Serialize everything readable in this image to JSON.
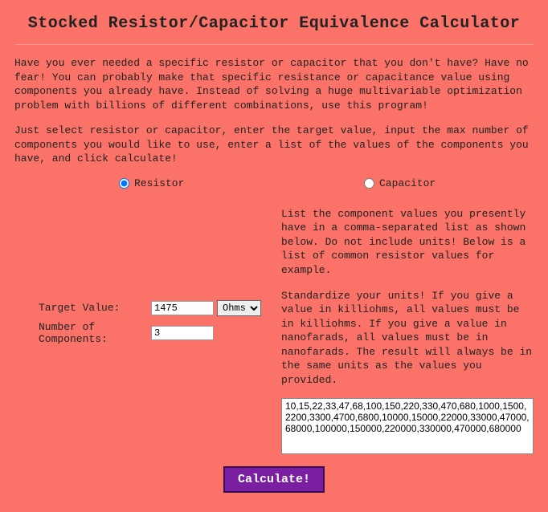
{
  "title": "Stocked Resistor/Capacitor Equivalence Calculator",
  "intro1": "Have you ever needed a specific resistor or capacitor that you don't have? Have no fear! You can probably make that specific resistance or capacitance value using components you already have. Instead of solving a huge multivariable optimization problem with billions of different combinations, use this program!",
  "intro2": "Just select resistor or capacitor, enter the target value, input the max number of components you would like to use, enter a list of the values of the components you have, and click calculate!",
  "radio_resistor": "Resistor",
  "radio_capacitor": "Capacitor",
  "target_label": "Target Value:",
  "target_value": "1475",
  "unit_selected": "Ohms",
  "num_label": "Number of Components:",
  "num_value": "3",
  "right_p1": "List the component values you presently have in a comma-separated list as shown below. Do not include units! Below is a list of common resistor values for example.",
  "right_p2": "Standardize your units! If you give a value in killiohms, all values must be in killiohms. If you give a value in nanofarads, all values must be in nanofarads. The result will always be in the same units as the values you provided.",
  "component_list": "10,15,22,33,47,68,100,150,220,330,470,680,1000,1500,2200,3300,4700,6800,10000,15000,22000,33000,47000,68000,100000,150000,220000,330000,470000,680000",
  "calc_btn": "Calculate!"
}
